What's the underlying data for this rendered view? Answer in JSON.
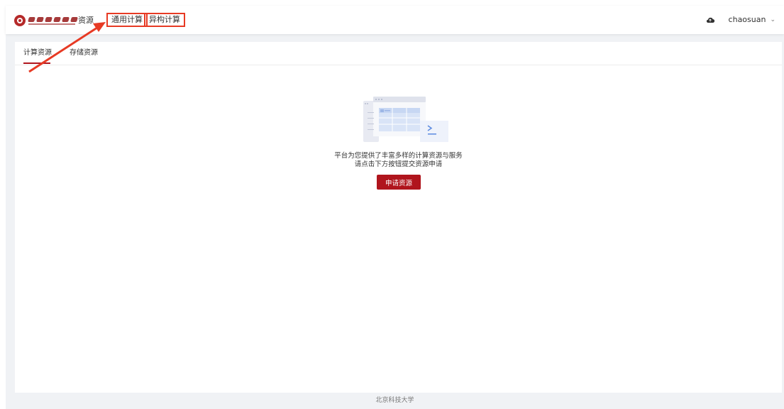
{
  "header": {
    "nav": {
      "resources": "资源",
      "general_compute": "通用计算",
      "hetero_compute": "异构计算"
    },
    "user": {
      "name": "chaosuan",
      "dropdown_icon": "chevron-down-icon",
      "cloud_icon": "cloud-icon"
    }
  },
  "tabs": [
    {
      "label": "计算资源",
      "active": true
    },
    {
      "label": "存储资源",
      "active": false
    }
  ],
  "empty_state": {
    "line1": "平台为您提供了丰富多样的计算资源与服务",
    "line2": "请点击下方按钮提交资源申请",
    "button": "申请资源"
  },
  "footer": {
    "text": "北京科技大学"
  },
  "colors": {
    "brand": "#b0151d",
    "annotation": "#e73a24",
    "background": "#f0f2f5"
  }
}
